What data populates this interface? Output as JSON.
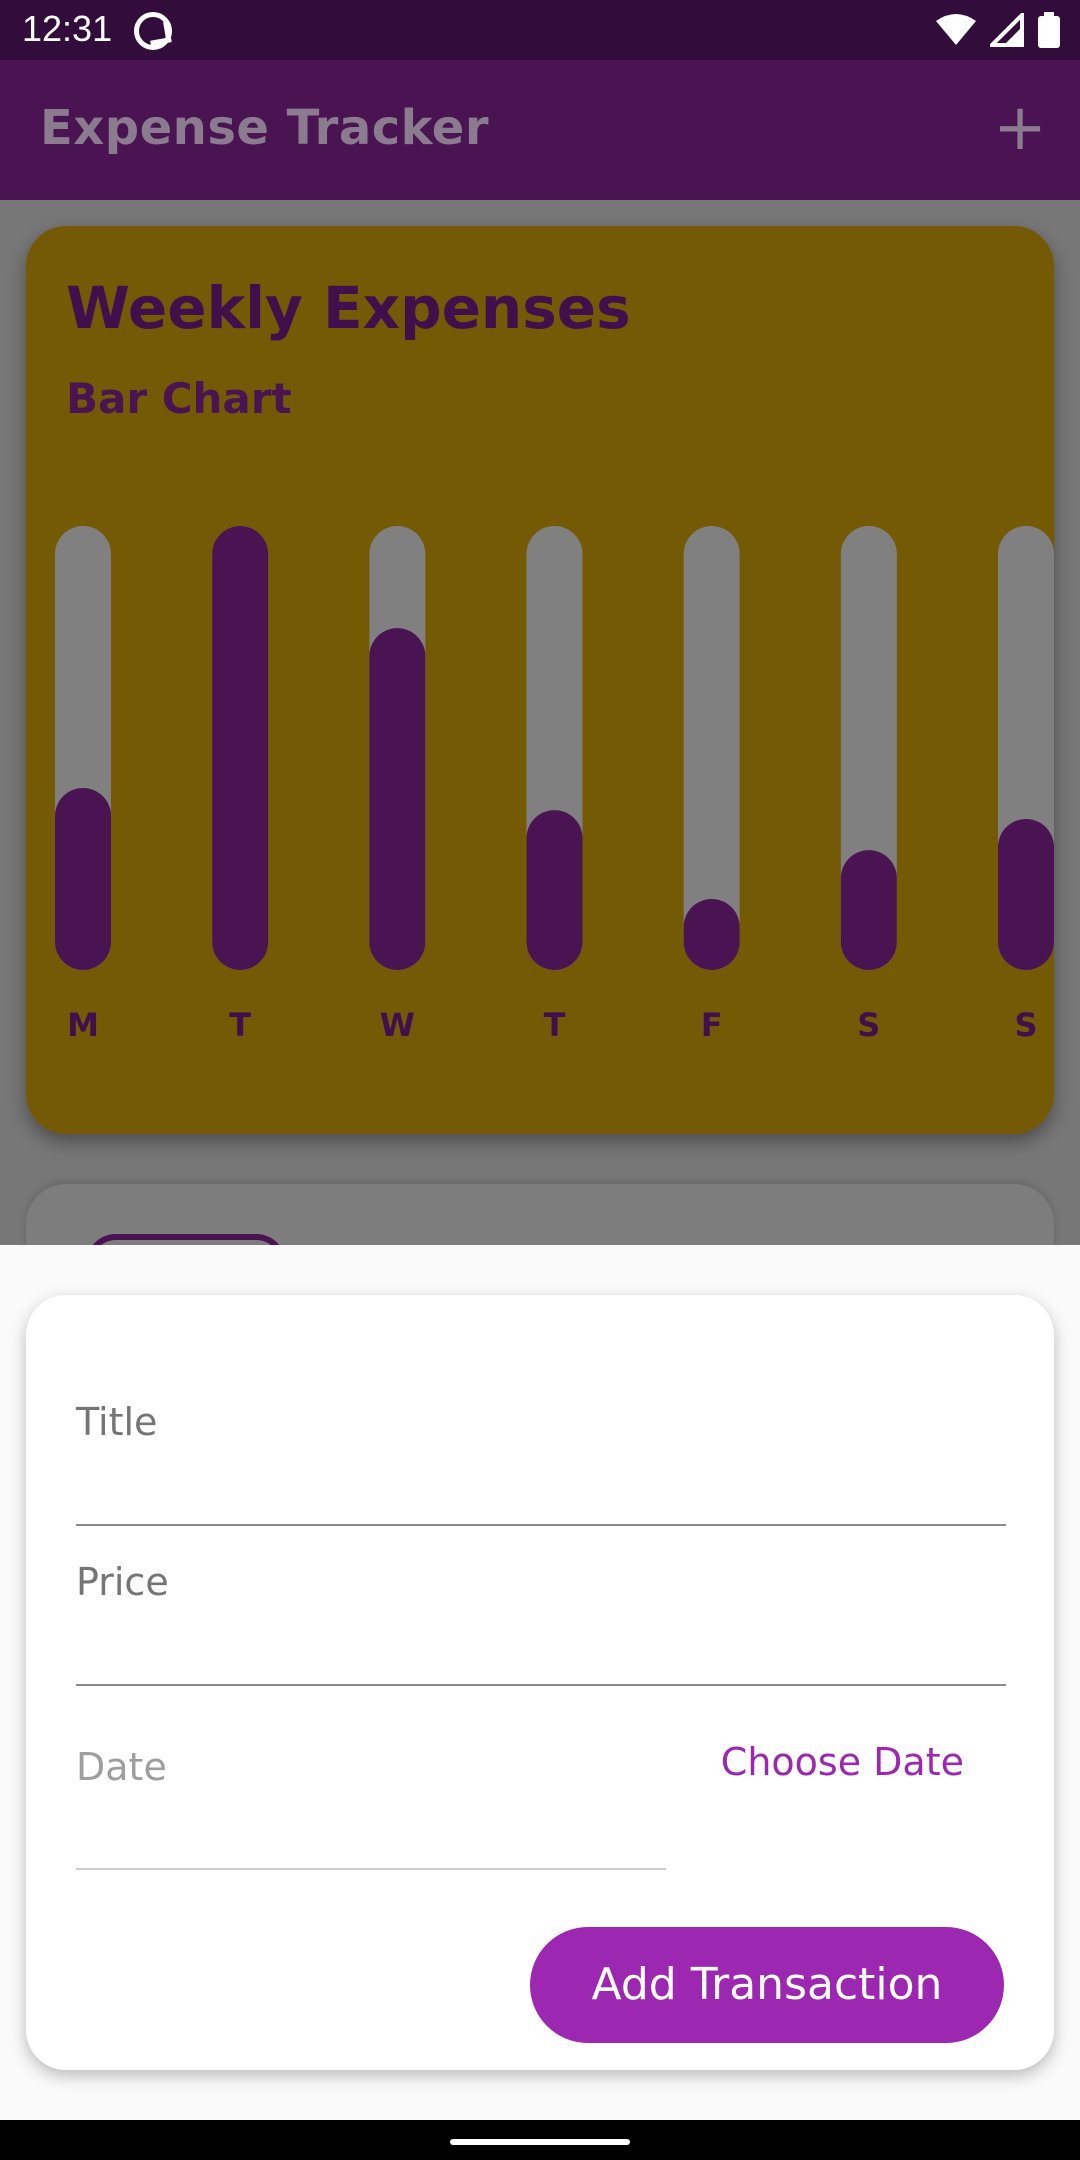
{
  "status_bar": {
    "time": "12:31",
    "icons": [
      "app-notification-icon",
      "wifi-icon",
      "signal-icon",
      "battery-icon"
    ]
  },
  "app_bar": {
    "title": "Expense Tracker",
    "add_icon": "plus-icon",
    "add_label": "+"
  },
  "chart": {
    "title": "Weekly Expenses",
    "subtitle": "Bar Chart"
  },
  "chart_data": {
    "type": "bar",
    "categories": [
      "M",
      "T",
      "W",
      "T",
      "F",
      "S",
      "S"
    ],
    "values": [
      0.41,
      1.0,
      0.77,
      0.36,
      0.16,
      0.27,
      0.34
    ],
    "ylim": [
      0,
      1
    ],
    "grid": false,
    "colors": {
      "fill": "#4a1452",
      "track": "#808080",
      "background": "#745a04"
    }
  },
  "form": {
    "title_placeholder": "Title",
    "price_placeholder": "Price",
    "date_placeholder": "Date",
    "choose_date_label": "Choose Date",
    "submit_label": "Add Transaction"
  },
  "colors": {
    "primary": "#9c27b0",
    "app_bar": "#4a1452",
    "accent": "#745a04"
  }
}
